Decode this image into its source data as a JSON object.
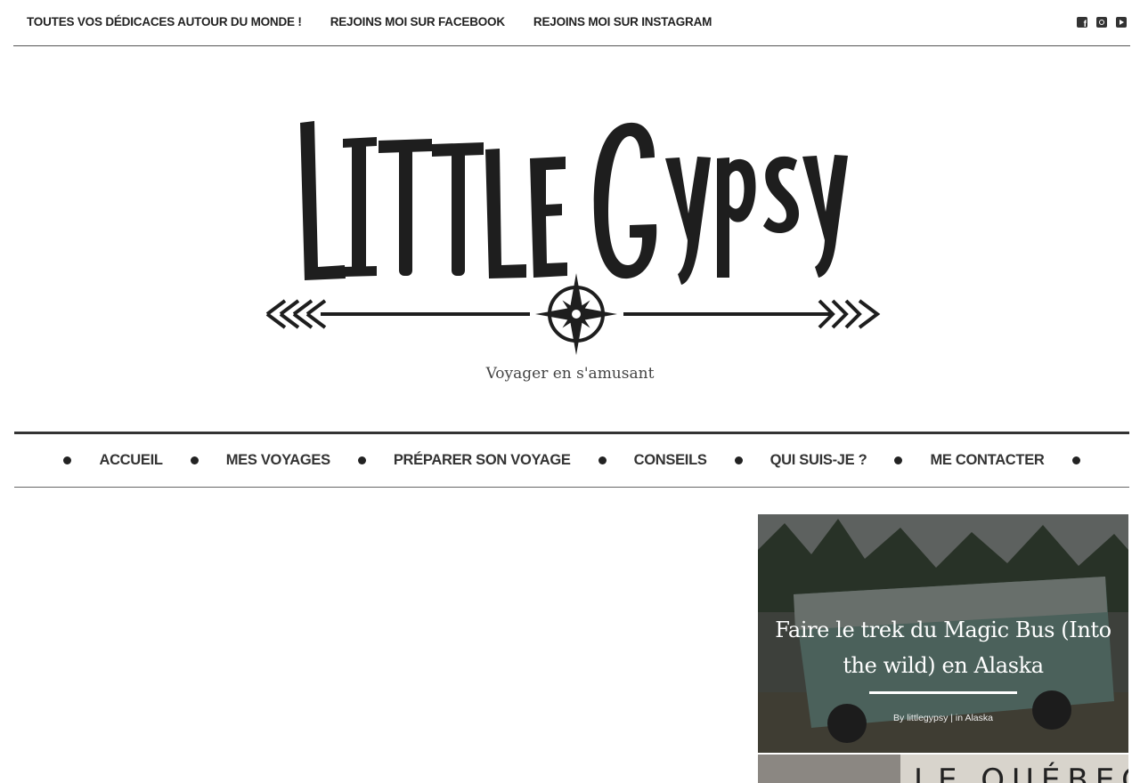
{
  "topbar": {
    "links": [
      {
        "label": "TOUTES VOS DÉDICACES AUTOUR DU MONDE !"
      },
      {
        "label": "REJOINS MOI SUR FACEBOOK"
      },
      {
        "label": "REJOINS MOI SUR INSTAGRAM"
      }
    ],
    "social_icons": [
      "facebook-icon",
      "instagram-icon",
      "youtube-icon"
    ]
  },
  "brand": {
    "logo_text": "Little Gypsy",
    "tagline": "Voyager en s'amusant"
  },
  "nav": {
    "items": [
      {
        "label": "ACCUEIL"
      },
      {
        "label": "MES VOYAGES"
      },
      {
        "label": "PRÉPARER SON VOYAGE"
      },
      {
        "label": "CONSEILS"
      },
      {
        "label": "QUI SUIS-JE ?"
      },
      {
        "label": "ME CONTACTER"
      }
    ]
  },
  "featured": {
    "title": "Faire le trek du Magic Bus (Into the wild) en Alaska",
    "meta_by": "By",
    "author": "littlegypsy",
    "meta_in": "| in",
    "category": "Alaska"
  },
  "next_card": {
    "partial_text": "LE QUÉBEC"
  },
  "colors": {
    "text": "#222222",
    "card_overlay": "#3a3a3a"
  }
}
